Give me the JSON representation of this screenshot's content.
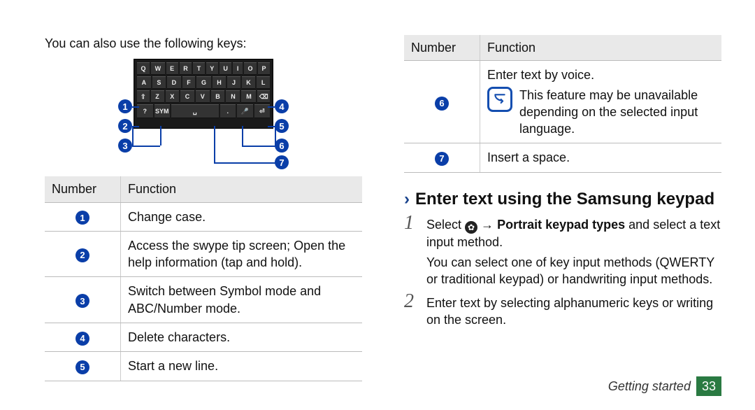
{
  "left": {
    "intro": "You can also use the following keys:",
    "keyboard_rows": [
      [
        "Q",
        "W",
        "E",
        "R",
        "T",
        "Y",
        "U",
        "I",
        "O",
        "P"
      ],
      [
        "A",
        "S",
        "D",
        "F",
        "G",
        "H",
        "J",
        "K",
        "L"
      ],
      [
        "⇧",
        "Z",
        "X",
        "C",
        "V",
        "B",
        "N",
        "M",
        "⌫"
      ],
      [
        "?",
        "SYM",
        "␣",
        "↵",
        "🎤",
        "⏎"
      ]
    ],
    "callout_numbers": [
      "1",
      "2",
      "3",
      "4",
      "5",
      "6",
      "7"
    ],
    "table": {
      "headers": [
        "Number",
        "Function"
      ],
      "rows": [
        {
          "num": "1",
          "text": "Change case."
        },
        {
          "num": "2",
          "text": "Access the swype tip screen; Open the help information (tap and hold)."
        },
        {
          "num": "3",
          "text": "Switch between Symbol mode and ABC/Number mode."
        },
        {
          "num": "4",
          "text": "Delete characters."
        },
        {
          "num": "5",
          "text": "Start a new line."
        }
      ]
    }
  },
  "right": {
    "table": {
      "headers": [
        "Number",
        "Function"
      ],
      "rows": [
        {
          "num": "6",
          "text": "Enter text by voice.",
          "note": "This feature may be unavailable depending on the selected input language."
        },
        {
          "num": "7",
          "text": "Insert a space."
        }
      ]
    },
    "section_title": "Enter text using the Samsung keypad",
    "steps": [
      {
        "main_prefix": "Select ",
        "main_bold": "Portrait keypad types",
        "main_mid": " → ",
        "main_suffix": " and select a text input method.",
        "sub": "You can select one of key input methods (QWERTY or traditional keypad) or handwriting input methods."
      },
      {
        "main_prefix": "Enter text by selecting alphanumeric keys or writing on the screen.",
        "main_bold": "",
        "main_mid": "",
        "main_suffix": "",
        "sub": ""
      }
    ]
  },
  "footer": {
    "section": "Getting started",
    "page": "33"
  }
}
